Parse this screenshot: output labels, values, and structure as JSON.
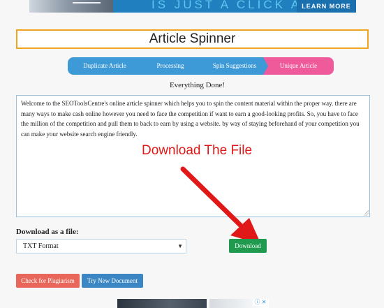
{
  "top_ad": {
    "headline": "IS JUST A CLICK AWAY",
    "cta_label": "LEARN MORE"
  },
  "page_title": "Article Spinner",
  "steps": [
    {
      "label": "Duplicate Article"
    },
    {
      "label": "Processing"
    },
    {
      "label": "Spin Suggestions"
    },
    {
      "label": "Unique Article"
    }
  ],
  "status_text": "Everything Done!",
  "article_text": "Welcome to the SEOToolsCentre's online article spinner which helps you to spin the content material within the proper way. there are many ways to make cash online however you need to face the competition if want to earn a good-looking profits. So, you have to face the million of the competition and pull them to back to earn by using a website. by way of staying beforehand of your competition you can make your website search engine friendly.",
  "annotation": "Download The File",
  "download": {
    "label": "Download as a file:",
    "selected_format": "TXT Format",
    "button_label": "Download"
  },
  "actions": {
    "plagiarism_label": "Check for Plagiarism",
    "new_document_label": "Try New Document"
  },
  "colors": {
    "step_blue": "#3e9ad6",
    "step_active_pink": "#ef5a9a",
    "title_border": "#f0a420",
    "download_green": "#1f9a4e",
    "plagiarism_red": "#e8675a",
    "new_doc_blue": "#3c87c3",
    "annotation_red": "#e01818"
  },
  "icons": {
    "select_caret": "chevron-down-icon",
    "annotation_arrow": "arrow-icon",
    "ad_choices": "ad-choices-icon"
  }
}
